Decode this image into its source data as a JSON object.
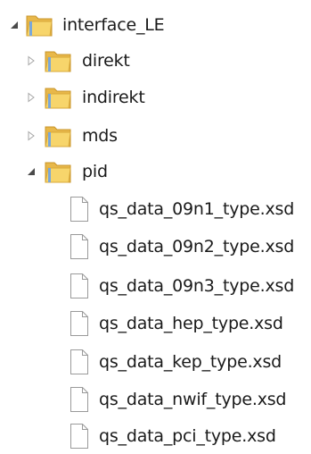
{
  "tree": {
    "root": {
      "label": "interface_LE",
      "expanded": true,
      "icon": "folder-icon",
      "children": [
        {
          "label": "direkt",
          "expanded": false,
          "icon": "folder-icon"
        },
        {
          "label": "indirekt",
          "expanded": false,
          "icon": "folder-icon"
        },
        {
          "label": "mds",
          "expanded": false,
          "icon": "folder-icon"
        },
        {
          "label": "pid",
          "expanded": true,
          "icon": "folder-icon",
          "files": [
            {
              "label": "qs_data_09n1_type.xsd",
              "icon": "file-icon"
            },
            {
              "label": "qs_data_09n2_type.xsd",
              "icon": "file-icon"
            },
            {
              "label": "qs_data_09n3_type.xsd",
              "icon": "file-icon"
            },
            {
              "label": "qs_data_hep_type.xsd",
              "icon": "file-icon"
            },
            {
              "label": "qs_data_kep_type.xsd",
              "icon": "file-icon"
            },
            {
              "label": "qs_data_nwif_type.xsd",
              "icon": "file-icon"
            },
            {
              "label": "qs_data_pci_type.xsd",
              "icon": "file-icon"
            }
          ]
        }
      ]
    }
  },
  "colors": {
    "folder_body": "#e8b84a",
    "folder_front": "#f7d56b",
    "folder_strap": "#7aa7d9",
    "expanded_arrow": "#4a4a4a",
    "collapsed_arrow": "#a6a6a6",
    "file_outline": "#9a9a9a"
  }
}
